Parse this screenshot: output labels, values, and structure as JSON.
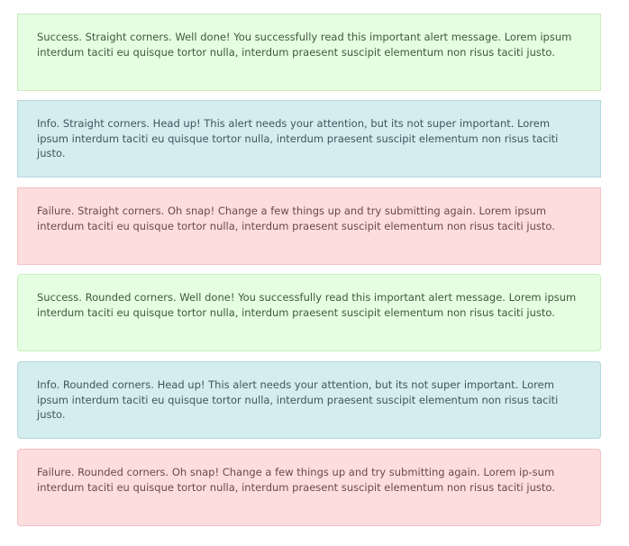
{
  "alerts": [
    {
      "type": "success",
      "corners": "straight",
      "text": "Success. Straight corners. Well done! You successfully read this important alert message. Lorem ipsum interdum taciti eu quisque tortor nulla, interdum praesent suscipit elementum non risus taciti justo."
    },
    {
      "type": "info",
      "corners": "straight",
      "text": "Info. Straight corners. Head up! This alert needs your attention, but its not super important. Lorem ipsum interdum taciti eu quisque tortor nulla, interdum praesent suscipit elementum non risus taciti justo."
    },
    {
      "type": "failure",
      "corners": "straight",
      "text": "Failure. Straight corners. Oh snap! Change a few things up and try submitting again. Lorem ipsum interdum taciti eu quisque tortor nulla, interdum praesent suscipit elementum non risus taciti justo."
    },
    {
      "type": "success",
      "corners": "rounded",
      "text": "Success. Rounded corners. Well done! You successfully read this important alert message. Lorem ipsum interdum taciti eu quisque tortor nulla, interdum praesent suscipit elementum non risus taciti justo."
    },
    {
      "type": "info",
      "corners": "rounded",
      "text": "Info. Rounded corners. Head up! This alert needs your attention, but its not super important. Lorem ipsum interdum taciti eu quisque tortor nulla, interdum praesent suscipit elementum non risus taciti justo."
    },
    {
      "type": "failure",
      "corners": "rounded",
      "text": "Failure. Rounded corners. Oh snap! Change a few things up and try submitting again.  Lorem ip-sum interdum taciti eu quisque tortor nulla, interdum praesent suscipit elementum non risus taciti justo."
    }
  ],
  "colors": {
    "success_bg": "#e5fde0",
    "info_bg": "#d4edee",
    "failure_bg": "#fdddde"
  }
}
